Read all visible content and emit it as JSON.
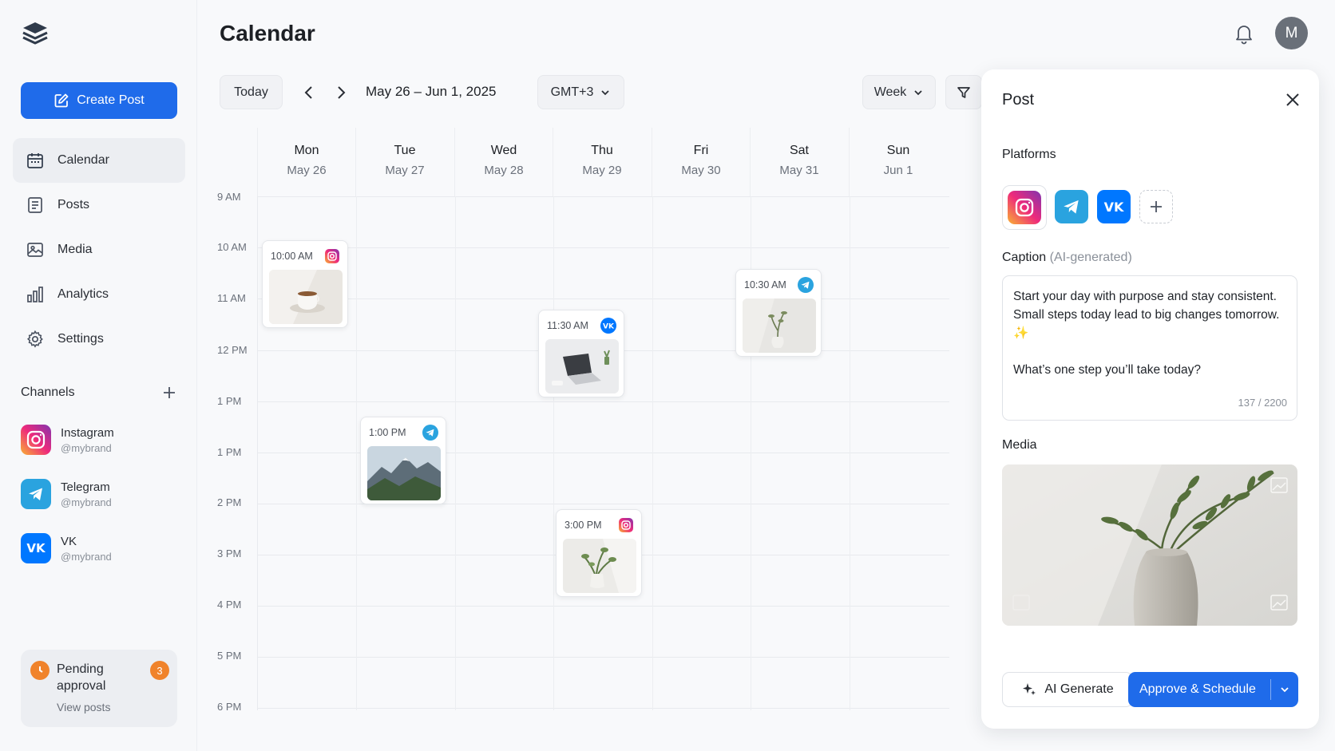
{
  "sidebar": {
    "create_label": "Create Post",
    "nav": [
      {
        "label": "Calendar",
        "icon": "calendar-icon"
      },
      {
        "label": "Posts",
        "icon": "document-icon"
      },
      {
        "label": "Media",
        "icon": "image-icon"
      },
      {
        "label": "Analytics",
        "icon": "bar-chart-icon"
      },
      {
        "label": "Settings",
        "icon": "gear-icon"
      }
    ],
    "channels_title": "Channels",
    "channels": [
      {
        "name": "Instagram",
        "handle": "@mybrand"
      },
      {
        "name": "Telegram",
        "handle": "@mybrand"
      },
      {
        "name": "VK",
        "handle": "@mybrand"
      }
    ],
    "pending": {
      "title": "Pending approval",
      "count": "3",
      "link": "View posts"
    }
  },
  "header": {
    "title": "Calendar",
    "avatar_initial": "M"
  },
  "toolbar": {
    "today": "Today",
    "range": "May 26 – Jun 1, 2025",
    "timezone": "GMT+3",
    "view": "Week"
  },
  "calendar": {
    "days": [
      {
        "name": "Mon",
        "date": "May 26"
      },
      {
        "name": "Tue",
        "date": "May 27"
      },
      {
        "name": "Wed",
        "date": "May 28"
      },
      {
        "name": "Thu",
        "date": "May 29"
      },
      {
        "name": "Fri",
        "date": "May 30"
      },
      {
        "name": "Sat",
        "date": "May 31"
      },
      {
        "name": "Sun",
        "date": "Jun 1"
      }
    ],
    "hours": [
      "9 AM",
      "10 AM",
      "11 AM",
      "12 PM",
      "1 PM",
      "1 PM",
      "2 PM",
      "3 PM",
      "4 PM",
      "5 PM",
      "6 PM"
    ],
    "events": [
      {
        "time": "10:00 AM",
        "platform": "instagram",
        "image": "coffee-cup-photo"
      },
      {
        "time": "1:00 PM",
        "platform": "telegram",
        "image": "mountain-photo"
      },
      {
        "time": "11:30 AM",
        "platform": "vk",
        "image": "laptop-desk-photo"
      },
      {
        "time": "3:00 PM",
        "platform": "instagram",
        "image": "plant-vase-photo"
      },
      {
        "time": "10:30 AM",
        "platform": "telegram",
        "image": "vase-branch-photo"
      }
    ]
  },
  "panel": {
    "title": "Post",
    "platforms_label": "Platforms",
    "caption_label": "Caption",
    "caption_hint": "(AI-generated)",
    "caption_text": "Start your day with purpose and stay consistent. Small steps today lead to big changes tomorrow. ✨\n\nWhat’s one step you’ll take today?",
    "caption_count": "137 / 2200",
    "media_label": "Media",
    "ai_button": "AI Generate",
    "approve_button": "Approve & Schedule"
  },
  "colors": {
    "accent": "#1f6bea",
    "instagram": "#e1306c",
    "telegram": "#2aa3df",
    "vk": "#0077ff",
    "pending": "#f0832b"
  }
}
